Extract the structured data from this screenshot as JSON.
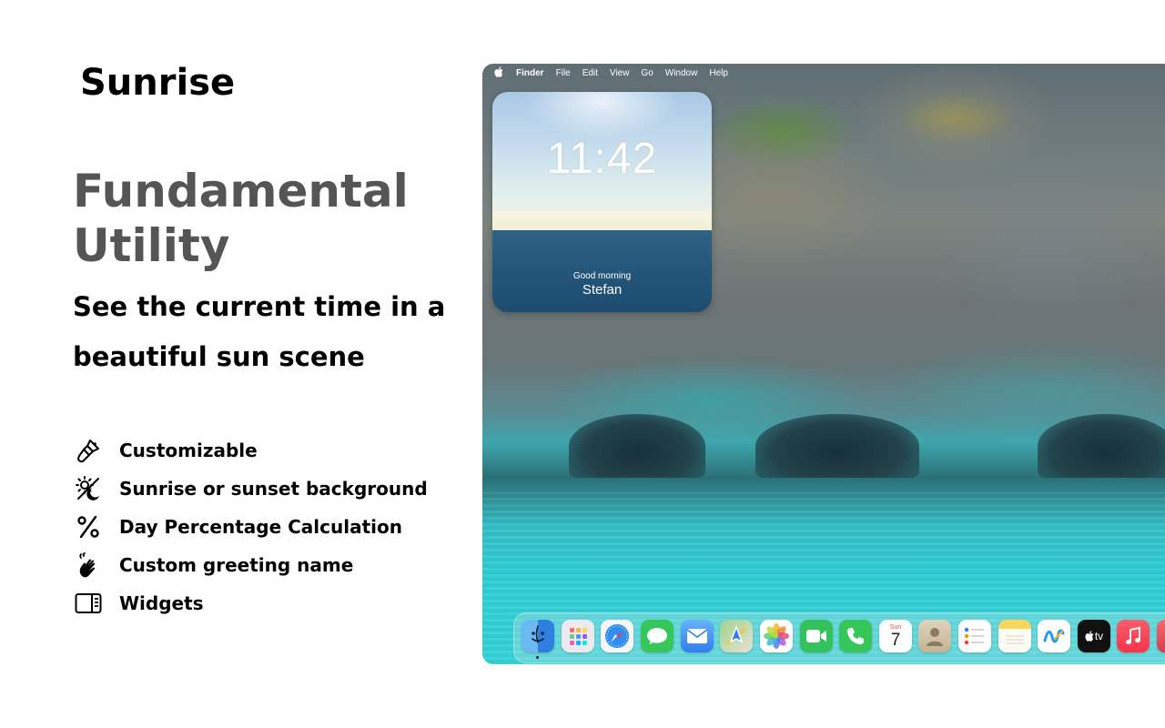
{
  "app_name": "Sunrise",
  "headline": "Fundamental Utility",
  "subhead": "See the current time in a beautiful sun scene",
  "features": [
    {
      "icon": "paintbrush-icon",
      "label": "Customizable"
    },
    {
      "icon": "sun-moon-icon",
      "label": "Sunrise or sunset background"
    },
    {
      "icon": "percent-icon",
      "label": "Day Percentage Calculation"
    },
    {
      "icon": "hand-wave-icon",
      "label": "Custom greeting name"
    },
    {
      "icon": "widget-sidebar-icon",
      "label": "Widgets"
    }
  ],
  "menubar": {
    "apple": "",
    "items": [
      "Finder",
      "File",
      "Edit",
      "View",
      "Go",
      "Window",
      "Help"
    ]
  },
  "widget": {
    "time": "11:42",
    "greeting": "Good morning",
    "name": "Stefan"
  },
  "dock": {
    "apps": [
      {
        "name": "Finder",
        "icon": "finder-icon",
        "color": "#2f8de4"
      },
      {
        "name": "Launchpad",
        "icon": "launchpad-icon",
        "color": "#e9e9ee"
      },
      {
        "name": "Safari",
        "icon": "safari-icon",
        "color": "#3a8ee6"
      },
      {
        "name": "Messages",
        "icon": "messages-icon",
        "color": "#35c759"
      },
      {
        "name": "Mail",
        "icon": "mail-icon",
        "color": "#3d86f0"
      },
      {
        "name": "Maps",
        "icon": "maps-icon",
        "color": "#67c56a"
      },
      {
        "name": "Photos",
        "icon": "photos-icon",
        "color": "#ffffff"
      },
      {
        "name": "FaceTime",
        "icon": "facetime-icon",
        "color": "#33c25c"
      },
      {
        "name": "Phone",
        "icon": "phone-icon",
        "color": "#35c759"
      },
      {
        "name": "Calendar",
        "icon": "calendar-icon",
        "color": "#ffffff",
        "label_top": "Sun",
        "label_day": "7"
      },
      {
        "name": "Contacts",
        "icon": "contacts-icon",
        "color": "#c9b99c"
      },
      {
        "name": "Reminders",
        "icon": "reminders-icon",
        "color": "#ffffff"
      },
      {
        "name": "Notes",
        "icon": "notes-icon",
        "color": "#f9e070"
      },
      {
        "name": "Freeform",
        "icon": "freeform-icon",
        "color": "#ffffff"
      },
      {
        "name": "TV",
        "icon": "tv-icon",
        "color": "#111111",
        "label_top": "tv"
      },
      {
        "name": "Music",
        "icon": "music-icon",
        "color": "#fb4254"
      },
      {
        "name": "Podcasts",
        "icon": "podcasts-icon",
        "color": "#f35b5b"
      }
    ]
  }
}
